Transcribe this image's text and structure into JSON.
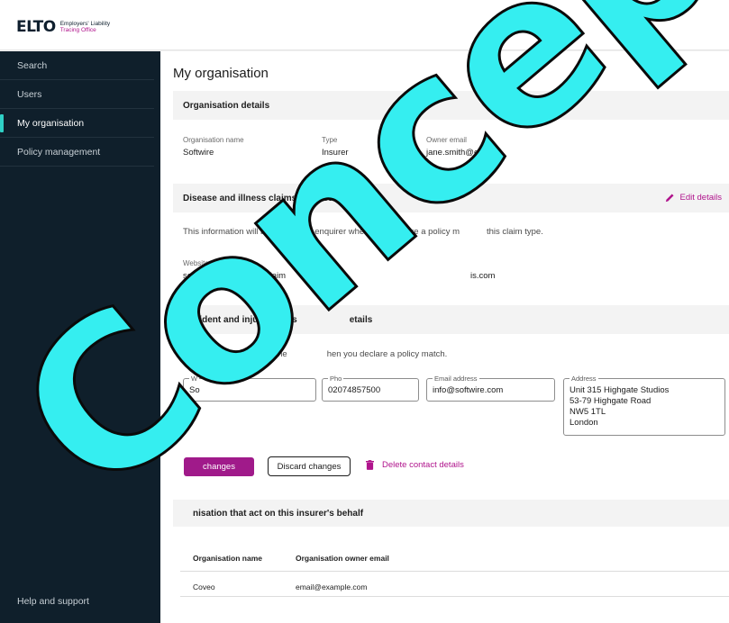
{
  "header": {
    "logo_mark_el": "EL",
    "logo_mark_to": "TO",
    "logo_line1": "Employers' Liability",
    "logo_line2": "Tracing Office"
  },
  "sidebar": {
    "items": [
      {
        "label": "Search"
      },
      {
        "label": "Users"
      },
      {
        "label": "My organisation"
      },
      {
        "label": "Policy management"
      }
    ],
    "help_label": "Help and support"
  },
  "page": {
    "title": "My organisation"
  },
  "org_details": {
    "heading": "Organisation details",
    "name_label": "Organisation name",
    "name_value": "Softwire",
    "type_label": "Type",
    "type_value": "Insurer",
    "owner_label": "Owner email",
    "owner_value": "jane.smith@e"
  },
  "disease": {
    "heading": "Disease and illness claims contact details",
    "edit_label": "Edit details",
    "info": "This information will be sent to the enquirer when yo",
    "info_tail": "re a policy m",
    "info_end": "this claim type.",
    "website_label": "Website",
    "website_value": "softwire.com/disease-claim",
    "email_tail": "is.com"
  },
  "accident": {
    "heading": "Accident and injury claims",
    "heading_tail": "etails",
    "info": "This info",
    "info_mid": "to the",
    "info_end": "hen you declare a policy match.",
    "website_legend": "W",
    "website_value": "So",
    "phone_legend": "Pho",
    "phone_value": "02074857500",
    "email_legend": "Email address",
    "email_value": "info@softwire.com",
    "address_legend": "Address",
    "address_lines": [
      "Unit 315 Highgate Studios",
      "53-79 Highgate Road",
      "NW5 1TL",
      "London"
    ],
    "save_label": "changes",
    "discard_label": "Discard changes",
    "delete_label": "Delete contact details"
  },
  "acting_orgs": {
    "heading": "nisation that act on this insurer's behalf",
    "col_name": "Organisation name",
    "col_email": "Organisation owner email",
    "rows": [
      {
        "name": "Coveo",
        "email": "email@example.com"
      }
    ]
  },
  "watermark": {
    "text": "Concept"
  },
  "colors": {
    "accent": "#b0148c",
    "sidebar_bg": "#0f1f2b",
    "active_marker": "#2fd0c6",
    "watermark": "#35eef0"
  }
}
